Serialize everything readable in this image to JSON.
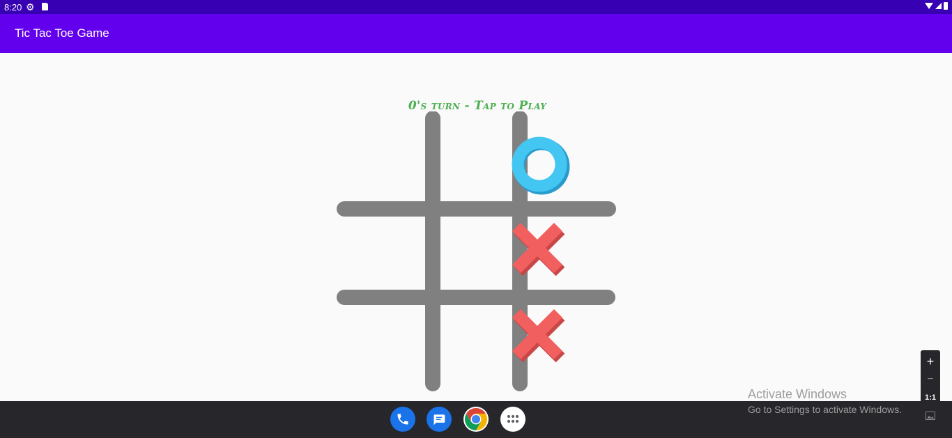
{
  "status_bar": {
    "time": "8:20",
    "icons": [
      "settings-icon",
      "sd-card-icon",
      "wifi-icon",
      "signal-icon",
      "battery-icon"
    ]
  },
  "app_bar": {
    "title": "Tic Tac Toe Game"
  },
  "game": {
    "turn_text": "0's turn - Tap to Play",
    "board": [
      [
        "",
        "O",
        ""
      ],
      [
        "",
        "X",
        ""
      ],
      [
        "",
        "X",
        ""
      ]
    ],
    "colors": {
      "grid": "#808080",
      "o": "#40c4f0",
      "x": "#f25f5f",
      "turn_text": "#4caf50"
    }
  },
  "taskbar": {
    "apps": [
      "phone-icon",
      "messages-icon",
      "chrome-icon",
      "app-drawer-icon"
    ]
  },
  "watermark": {
    "title": "Activate Windows",
    "subtitle": "Go to Settings to activate Windows."
  },
  "zoom_controls": {
    "zoom_in": "+",
    "zoom_out": "−",
    "reset": "1:1"
  }
}
